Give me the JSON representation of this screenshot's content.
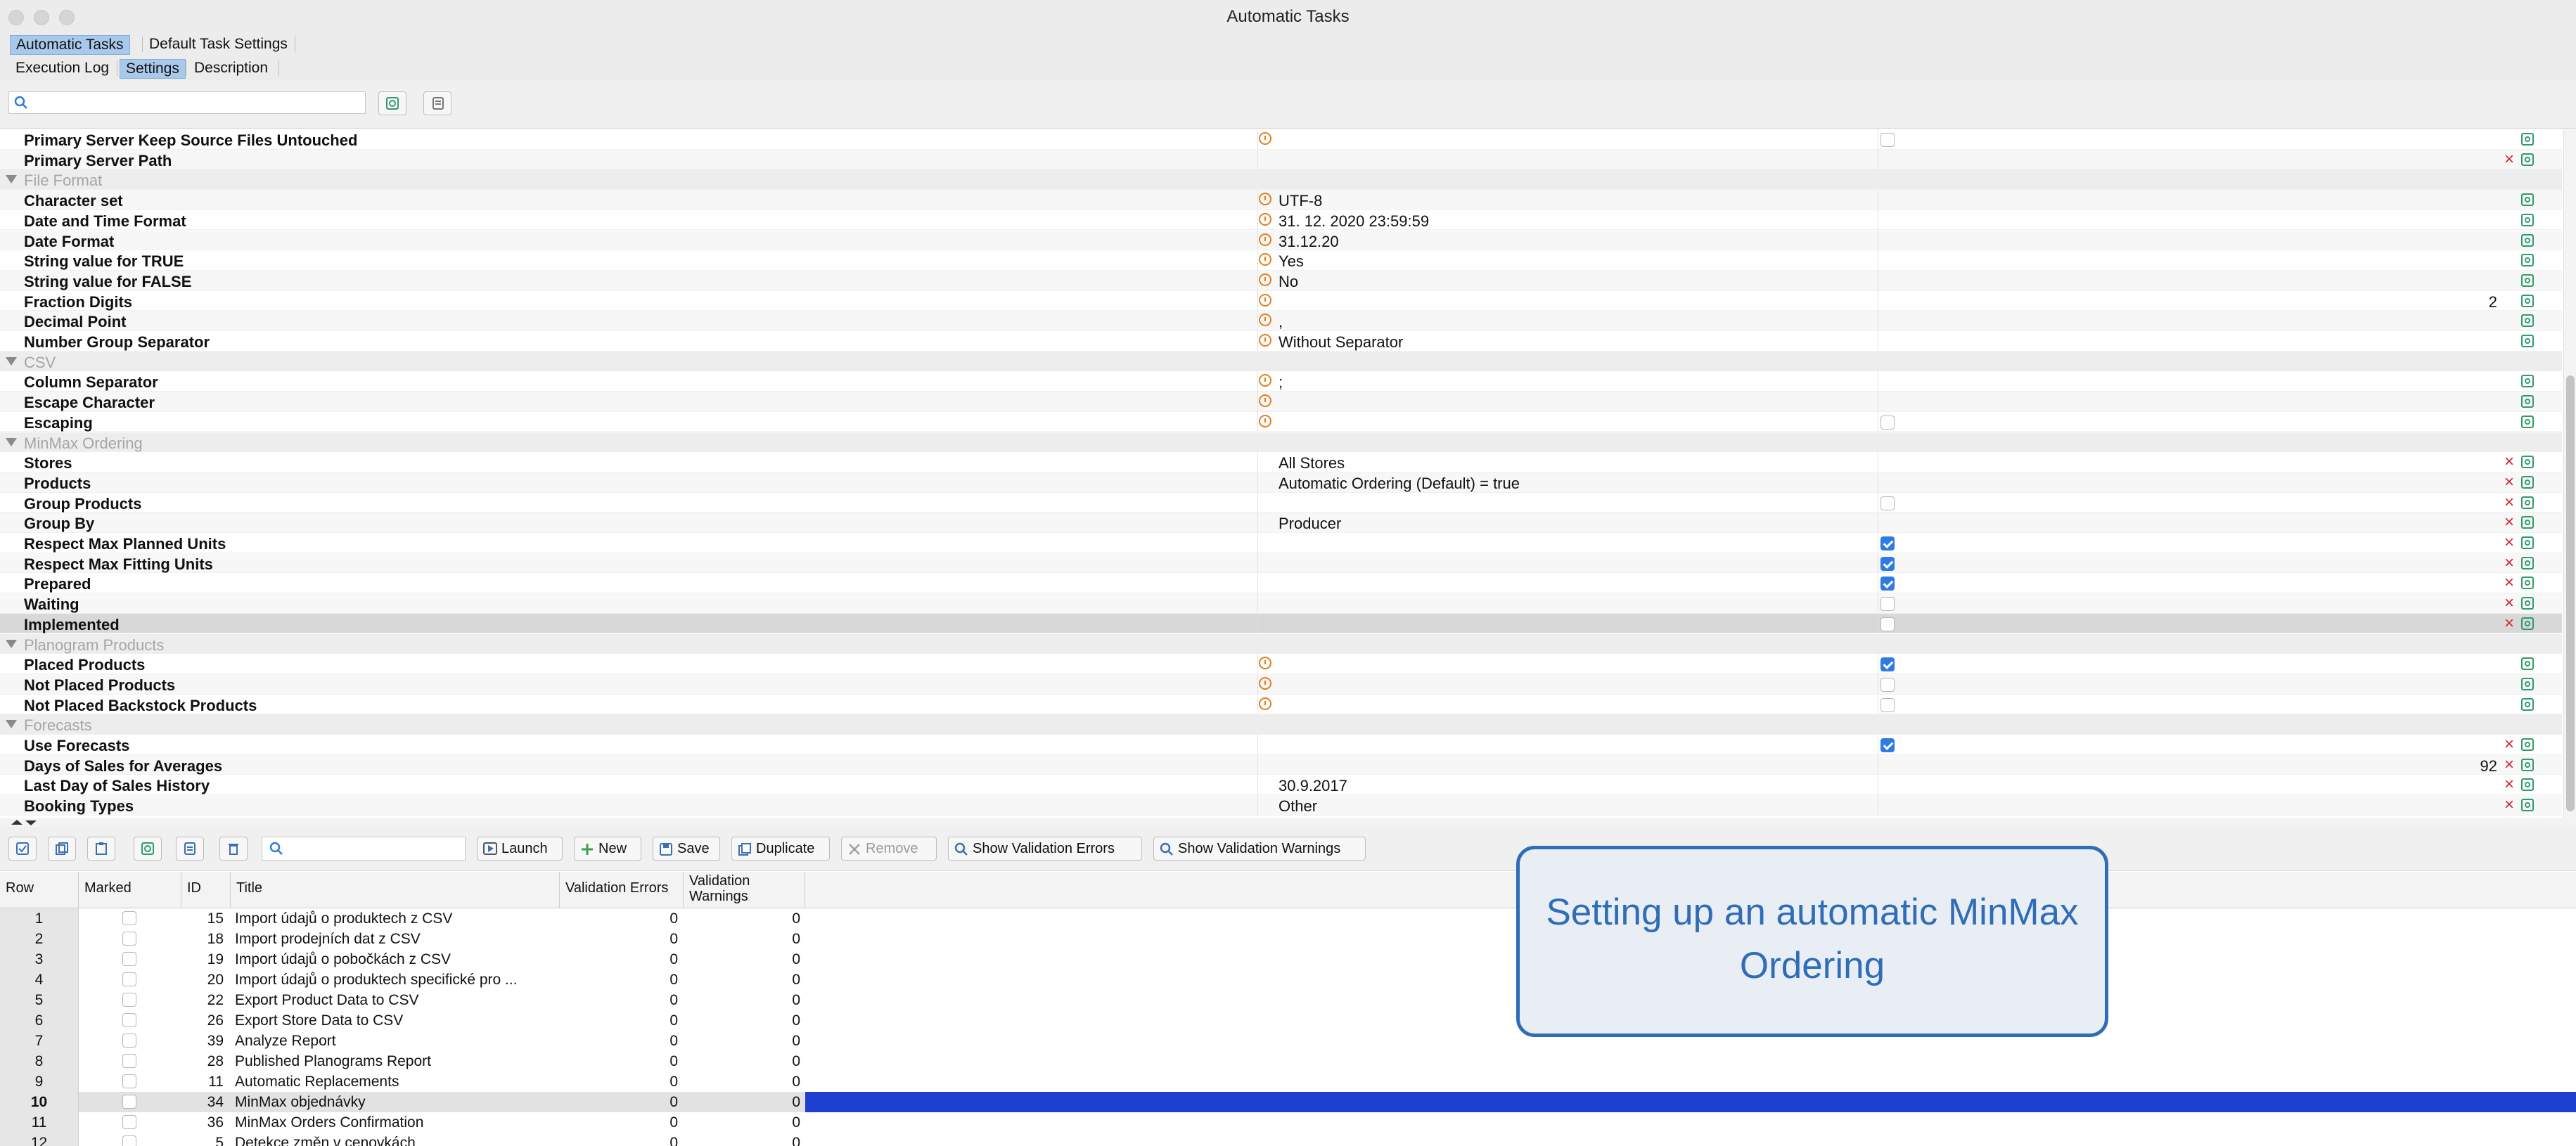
{
  "window": {
    "title": "Automatic Tasks"
  },
  "tabs_top": [
    {
      "label": "Automatic Tasks",
      "active": true
    },
    {
      "label": "Default Task Settings",
      "active": false
    }
  ],
  "tabs_sub": [
    {
      "label": "Execution Log",
      "active": false
    },
    {
      "label": "Settings",
      "active": true
    },
    {
      "label": "Description",
      "active": false
    }
  ],
  "search": {
    "placeholder": "",
    "value": ""
  },
  "settings": {
    "rows": [
      {
        "type": "item",
        "label": "Primary Server Keep Source Files Untouched",
        "clock": true,
        "value": "",
        "checkbox": "off",
        "remove": false,
        "edit": true
      },
      {
        "type": "item",
        "label": "Primary Server Path",
        "clock": false,
        "value": "",
        "checkbox": null,
        "remove": true,
        "edit": true
      },
      {
        "type": "section",
        "label": "File Format"
      },
      {
        "type": "item",
        "label": "Character set",
        "clock": true,
        "value": "UTF-8",
        "checkbox": null,
        "remove": false,
        "edit": true
      },
      {
        "type": "item",
        "label": "Date and Time Format",
        "clock": true,
        "value": "31. 12. 2020 23:59:59",
        "checkbox": null,
        "remove": false,
        "edit": true
      },
      {
        "type": "item",
        "label": "Date Format",
        "clock": true,
        "value": "31.12.20",
        "checkbox": null,
        "remove": false,
        "edit": true
      },
      {
        "type": "item",
        "label": "String value for TRUE",
        "clock": true,
        "value": "Yes",
        "checkbox": null,
        "remove": false,
        "edit": true
      },
      {
        "type": "item",
        "label": "String value for FALSE",
        "clock": true,
        "value": "No",
        "checkbox": null,
        "remove": false,
        "edit": true
      },
      {
        "type": "item",
        "label": "Fraction Digits",
        "clock": true,
        "value": "",
        "number": "2",
        "checkbox": null,
        "remove": false,
        "edit": true
      },
      {
        "type": "item",
        "label": "Decimal Point",
        "clock": true,
        "value": ",",
        "checkbox": null,
        "remove": false,
        "edit": true
      },
      {
        "type": "item",
        "label": "Number Group Separator",
        "clock": true,
        "value": "Without Separator",
        "checkbox": null,
        "remove": false,
        "edit": true
      },
      {
        "type": "section",
        "label": "CSV"
      },
      {
        "type": "item",
        "label": "Column Separator",
        "clock": true,
        "value": ";",
        "checkbox": null,
        "remove": false,
        "edit": true
      },
      {
        "type": "item",
        "label": "Escape Character",
        "clock": true,
        "value": "",
        "checkbox": null,
        "remove": false,
        "edit": true
      },
      {
        "type": "item",
        "label": "Escaping",
        "clock": true,
        "value": "",
        "checkbox": "off",
        "remove": false,
        "edit": true
      },
      {
        "type": "section",
        "label": "MinMax Ordering"
      },
      {
        "type": "item",
        "label": "Stores",
        "clock": false,
        "value": "All Stores",
        "checkbox": null,
        "remove": true,
        "edit": true
      },
      {
        "type": "item",
        "label": "Products",
        "clock": false,
        "value": "Automatic Ordering (Default) = true",
        "checkbox": null,
        "remove": true,
        "edit": true
      },
      {
        "type": "item",
        "label": "Group Products",
        "clock": false,
        "value": "",
        "checkbox": "off",
        "remove": true,
        "edit": true
      },
      {
        "type": "item",
        "label": "Group By",
        "clock": false,
        "value": "Producer",
        "checkbox": null,
        "remove": true,
        "edit": true
      },
      {
        "type": "item",
        "label": "Respect Max Planned Units",
        "clock": false,
        "value": "",
        "checkbox": "on",
        "remove": true,
        "edit": true
      },
      {
        "type": "item",
        "label": "Respect Max Fitting Units",
        "clock": false,
        "value": "",
        "checkbox": "on",
        "remove": true,
        "edit": true
      },
      {
        "type": "item",
        "label": "Prepared",
        "clock": false,
        "value": "",
        "checkbox": "on",
        "remove": true,
        "edit": true
      },
      {
        "type": "item",
        "label": "Waiting",
        "clock": false,
        "value": "",
        "checkbox": "off",
        "remove": true,
        "edit": true
      },
      {
        "type": "item",
        "label": "Implemented",
        "clock": false,
        "value": "",
        "checkbox": "off",
        "remove": true,
        "edit": true,
        "selected": true
      },
      {
        "type": "section",
        "label": "Planogram Products"
      },
      {
        "type": "item",
        "label": "Placed Products",
        "clock": true,
        "value": "",
        "checkbox": "on",
        "remove": false,
        "edit": true
      },
      {
        "type": "item",
        "label": "Not Placed Products",
        "clock": true,
        "value": "",
        "checkbox": "off",
        "remove": false,
        "edit": true
      },
      {
        "type": "item",
        "label": "Not Placed Backstock Products",
        "clock": true,
        "value": "",
        "checkbox": "off",
        "remove": false,
        "edit": true
      },
      {
        "type": "section",
        "label": "Forecasts"
      },
      {
        "type": "item",
        "label": "Use Forecasts",
        "clock": false,
        "value": "",
        "checkbox": "on",
        "remove": true,
        "edit": true
      },
      {
        "type": "item",
        "label": "Days of Sales for Averages",
        "clock": false,
        "value": "",
        "number": "92",
        "checkbox": null,
        "remove": true,
        "edit": true
      },
      {
        "type": "item",
        "label": "Last Day of Sales History",
        "clock": false,
        "value": "30.9.2017",
        "checkbox": null,
        "remove": true,
        "edit": true
      },
      {
        "type": "item",
        "label": "Booking Types",
        "clock": false,
        "value": "Other",
        "checkbox": null,
        "remove": true,
        "edit": true
      }
    ]
  },
  "toolbar2": {
    "search_value": "",
    "launch_label": "Launch",
    "new_label": "New",
    "save_label": "Save",
    "duplicate_label": "Duplicate",
    "remove_label": "Remove",
    "show_errors_label": "Show Validation Errors",
    "show_warnings_label": "Show Validation Warnings"
  },
  "table": {
    "headers": [
      "Row",
      "Marked",
      "ID",
      "Title",
      "Validation Errors",
      "Validation Warnings"
    ],
    "rows": [
      {
        "row": "1",
        "id": "15",
        "title": "Import údajů o produktech z CSV",
        "errors": "0",
        "warnings": "0"
      },
      {
        "row": "2",
        "id": "18",
        "title": "Import prodejních dat z CSV",
        "errors": "0",
        "warnings": "0"
      },
      {
        "row": "3",
        "id": "19",
        "title": "Import údajů o pobočkách z CSV",
        "errors": "0",
        "warnings": "0"
      },
      {
        "row": "4",
        "id": "20",
        "title": "Import údajů o produktech specifické pro ...",
        "errors": "0",
        "warnings": "0"
      },
      {
        "row": "5",
        "id": "22",
        "title": "Export Product Data to CSV",
        "errors": "0",
        "warnings": "0"
      },
      {
        "row": "6",
        "id": "26",
        "title": "Export Store Data to CSV",
        "errors": "0",
        "warnings": "0"
      },
      {
        "row": "7",
        "id": "39",
        "title": "Analyze Report",
        "errors": "0",
        "warnings": "0"
      },
      {
        "row": "8",
        "id": "28",
        "title": "Published Planograms Report",
        "errors": "0",
        "warnings": "0"
      },
      {
        "row": "9",
        "id": "11",
        "title": "Automatic Replacements",
        "errors": "0",
        "warnings": "0"
      },
      {
        "row": "10",
        "id": "34",
        "title": "MinMax objednávky",
        "errors": "0",
        "warnings": "0",
        "selected": true
      },
      {
        "row": "11",
        "id": "36",
        "title": "MinMax Orders Confirmation",
        "errors": "0",
        "warnings": "0"
      },
      {
        "row": "12",
        "id": "5",
        "title": "Detekce změn v cenovkách",
        "errors": "0",
        "warnings": "0"
      }
    ]
  },
  "callout": {
    "text": "Setting up an automatic MinMax Ordering"
  }
}
